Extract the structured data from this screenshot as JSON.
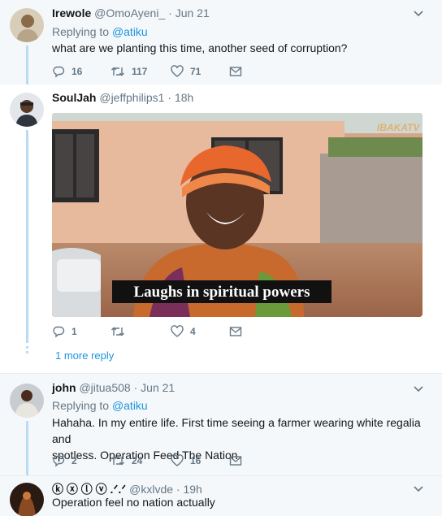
{
  "tweets": [
    {
      "name": "Irewole",
      "handle": "@OmoAyeni_",
      "time": "Jun 21",
      "replying_prefix": "Replying to",
      "replying_to": "@atiku",
      "text": "what are we planting this time, another seed of corruption?",
      "replies": "16",
      "retweets": "117",
      "likes": "71"
    },
    {
      "name": "SoulJah",
      "handle": "@jeffphilips1",
      "time": "18h",
      "media_caption": "Laughs in spiritual powers",
      "media_watermark": "IBAKATV",
      "replies": "1",
      "retweets": "",
      "likes": "4",
      "more_replies": "1 more reply"
    },
    {
      "name": "john",
      "handle": "@jitua508",
      "time": "Jun 21",
      "replying_prefix": "Replying to",
      "replying_to": "@atiku",
      "text_line1": "Hahaha. In my entire life. First time seeing a farmer wearing white regalia  and",
      "text_line2": "spotless. Operation Feed The Nation.",
      "replies": "2",
      "retweets": "24",
      "likes": "16"
    },
    {
      "name": "ⓚ ⓧ ⓛ ⓥ .ᐟ.ᐟ",
      "handle": "@kxlvde",
      "time": "19h",
      "text": "Operation feel no nation actually"
    }
  ],
  "colors": {
    "link": "#1b95e0",
    "muted": "#657786",
    "thread": "#b8dcf5",
    "highlight_bg": "#f5f8fa"
  },
  "icons": [
    "reply-icon",
    "retweet-icon",
    "like-icon",
    "message-icon",
    "chevron-down-icon"
  ]
}
